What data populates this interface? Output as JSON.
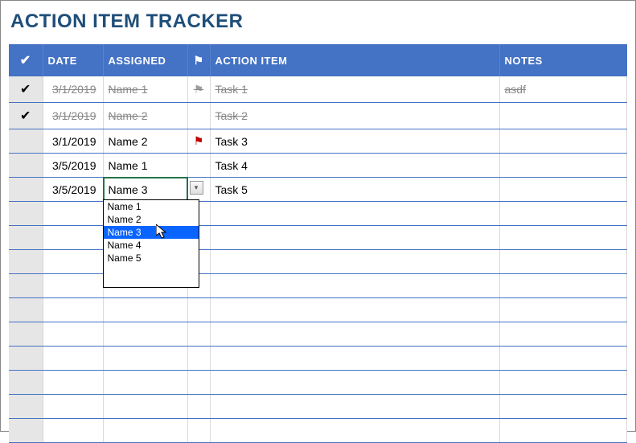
{
  "title": "ACTION ITEM TRACKER",
  "headers": {
    "date": "DATE",
    "assigned": "ASSIGNED",
    "action": "ACTION ITEM",
    "notes": "NOTES"
  },
  "rows": [
    {
      "done": true,
      "date": "3/1/2019",
      "assigned": "Name 1",
      "flag": "gray",
      "action": "Task 1",
      "notes": "asdf"
    },
    {
      "done": true,
      "date": "3/1/2019",
      "assigned": "Name 2",
      "flag": "",
      "action": "Task 2",
      "notes": ""
    },
    {
      "done": false,
      "date": "3/1/2019",
      "assigned": "Name 2",
      "flag": "red",
      "action": "Task 3",
      "notes": ""
    },
    {
      "done": false,
      "date": "3/5/2019",
      "assigned": "Name 1",
      "flag": "",
      "action": "Task 4",
      "notes": ""
    },
    {
      "done": false,
      "date": "3/5/2019",
      "assigned": "Name 3",
      "flag": "",
      "action": "Task 5",
      "notes": "",
      "editing": true
    }
  ],
  "empty_rows": 10,
  "dropdown": {
    "options": [
      "Name 1",
      "Name 2",
      "Name 3",
      "Name 4",
      "Name 5"
    ],
    "selected": "Name 3"
  }
}
